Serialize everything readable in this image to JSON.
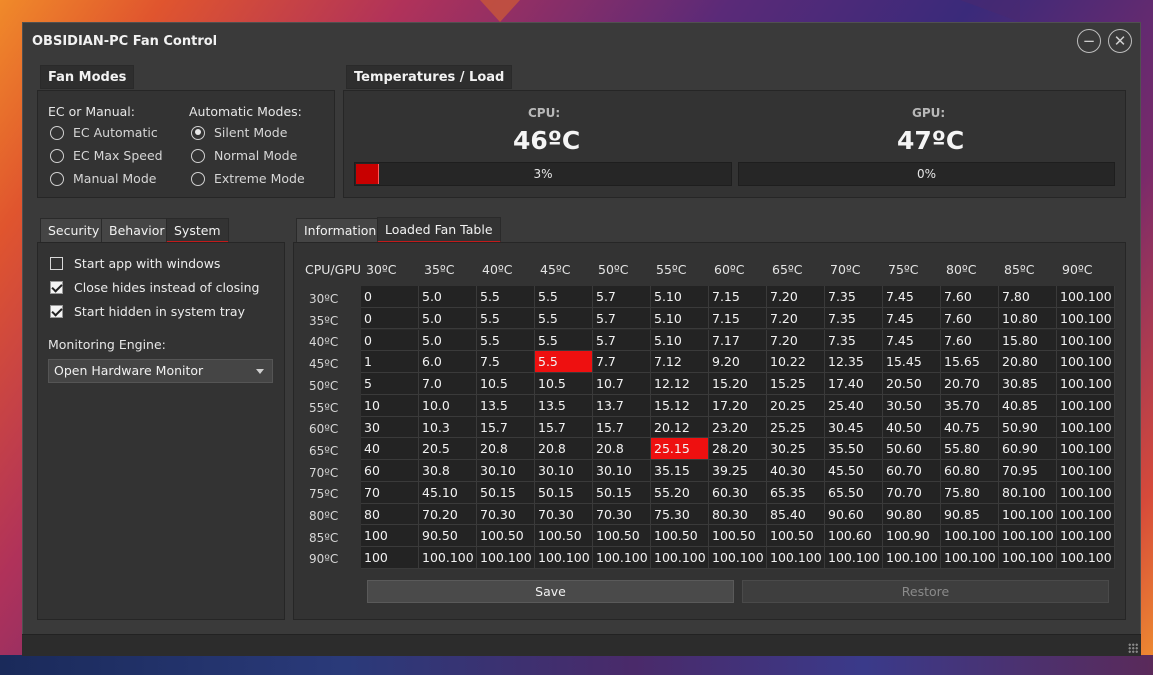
{
  "window": {
    "title": "OBSIDIAN-PC Fan Control"
  },
  "fan_modes": {
    "tab": "Fan Modes",
    "ec_header": "EC or Manual:",
    "auto_header": "Automatic Modes:",
    "ec_options": [
      {
        "label": "EC Automatic",
        "selected": false
      },
      {
        "label": "EC Max Speed",
        "selected": false
      },
      {
        "label": "Manual Mode",
        "selected": false
      }
    ],
    "auto_options": [
      {
        "label": "Silent Mode",
        "selected": true
      },
      {
        "label": "Normal Mode",
        "selected": false
      },
      {
        "label": "Extreme Mode",
        "selected": false
      }
    ]
  },
  "temps": {
    "tab": "Temperatures / Load",
    "cpu_label": "CPU:",
    "cpu_value": "46ºC",
    "cpu_load": "3%",
    "cpu_load_fraction": 0.03,
    "gpu_label": "GPU:",
    "gpu_value": "47ºC",
    "gpu_load": "0%",
    "gpu_load_fraction": 0.0
  },
  "settings_tabs": [
    "Security",
    "Behavior",
    "System"
  ],
  "system": {
    "checks": [
      {
        "label": "Start app with windows",
        "checked": false
      },
      {
        "label": "Close hides instead of closing",
        "checked": true
      },
      {
        "label": "Start hidden in system tray",
        "checked": true
      }
    ],
    "engine_label": "Monitoring Engine:",
    "engine_value": "Open Hardware Monitor"
  },
  "table_tabs": [
    "Information",
    "Loaded Fan Table"
  ],
  "fan_table": {
    "corner": "CPU/GPU",
    "gpu_temps": [
      "30ºC",
      "35ºC",
      "40ºC",
      "45ºC",
      "50ºC",
      "55ºC",
      "60ºC",
      "65ºC",
      "70ºC",
      "75ºC",
      "80ºC",
      "85ºC",
      "90ºC"
    ],
    "cpu_temps": [
      "30ºC",
      "35ºC",
      "40ºC",
      "45ºC",
      "50ºC",
      "55ºC",
      "60ºC",
      "65ºC",
      "70ºC",
      "75ºC",
      "80ºC",
      "85ºC",
      "90ºC"
    ],
    "rows": [
      [
        "0",
        "5.0",
        "5.5",
        "5.5",
        "5.7",
        "5.10",
        "7.15",
        "7.20",
        "7.35",
        "7.45",
        "7.60",
        "7.80",
        "100.100"
      ],
      [
        "0",
        "5.0",
        "5.5",
        "5.5",
        "5.7",
        "5.10",
        "7.15",
        "7.20",
        "7.35",
        "7.45",
        "7.60",
        "10.80",
        "100.100"
      ],
      [
        "0",
        "5.0",
        "5.5",
        "5.5",
        "5.7",
        "5.10",
        "7.17",
        "7.20",
        "7.35",
        "7.45",
        "7.60",
        "15.80",
        "100.100"
      ],
      [
        "1",
        "6.0",
        "7.5",
        "5.5",
        "7.7",
        "7.12",
        "9.20",
        "10.22",
        "12.35",
        "15.45",
        "15.65",
        "20.80",
        "100.100"
      ],
      [
        "5",
        "7.0",
        "10.5",
        "10.5",
        "10.7",
        "12.12",
        "15.20",
        "15.25",
        "17.40",
        "20.50",
        "20.70",
        "30.85",
        "100.100"
      ],
      [
        "10",
        "10.0",
        "13.5",
        "13.5",
        "13.7",
        "15.12",
        "17.20",
        "20.25",
        "25.40",
        "30.50",
        "35.70",
        "40.85",
        "100.100"
      ],
      [
        "30",
        "10.3",
        "15.7",
        "15.7",
        "15.7",
        "20.12",
        "23.20",
        "25.25",
        "30.45",
        "40.50",
        "40.75",
        "50.90",
        "100.100"
      ],
      [
        "40",
        "20.5",
        "20.8",
        "20.8",
        "20.8",
        "25.15",
        "28.20",
        "30.25",
        "35.50",
        "50.60",
        "55.80",
        "60.90",
        "100.100"
      ],
      [
        "60",
        "30.8",
        "30.10",
        "30.10",
        "30.10",
        "35.15",
        "39.25",
        "40.30",
        "45.50",
        "60.70",
        "60.80",
        "70.95",
        "100.100"
      ],
      [
        "70",
        "45.10",
        "50.15",
        "50.15",
        "50.15",
        "55.20",
        "60.30",
        "65.35",
        "65.50",
        "70.70",
        "75.80",
        "80.100",
        "100.100"
      ],
      [
        "80",
        "70.20",
        "70.30",
        "70.30",
        "70.30",
        "75.30",
        "80.30",
        "85.40",
        "90.60",
        "90.80",
        "90.85",
        "100.100",
        "100.100"
      ],
      [
        "100",
        "90.50",
        "100.50",
        "100.50",
        "100.50",
        "100.50",
        "100.50",
        "100.50",
        "100.60",
        "100.90",
        "100.100",
        "100.100",
        "100.100"
      ],
      [
        "100",
        "100.100",
        "100.100",
        "100.100",
        "100.100",
        "100.100",
        "100.100",
        "100.100",
        "100.100",
        "100.100",
        "100.100",
        "100.100",
        "100.100"
      ]
    ],
    "highlighted": [
      [
        3,
        3
      ],
      [
        7,
        5
      ]
    ],
    "highlight_color": "#ee1010"
  },
  "buttons": {
    "save": "Save",
    "restore": "Restore"
  },
  "colors": {
    "accent": "#c21b1b",
    "bar_fill": "#c80000"
  }
}
